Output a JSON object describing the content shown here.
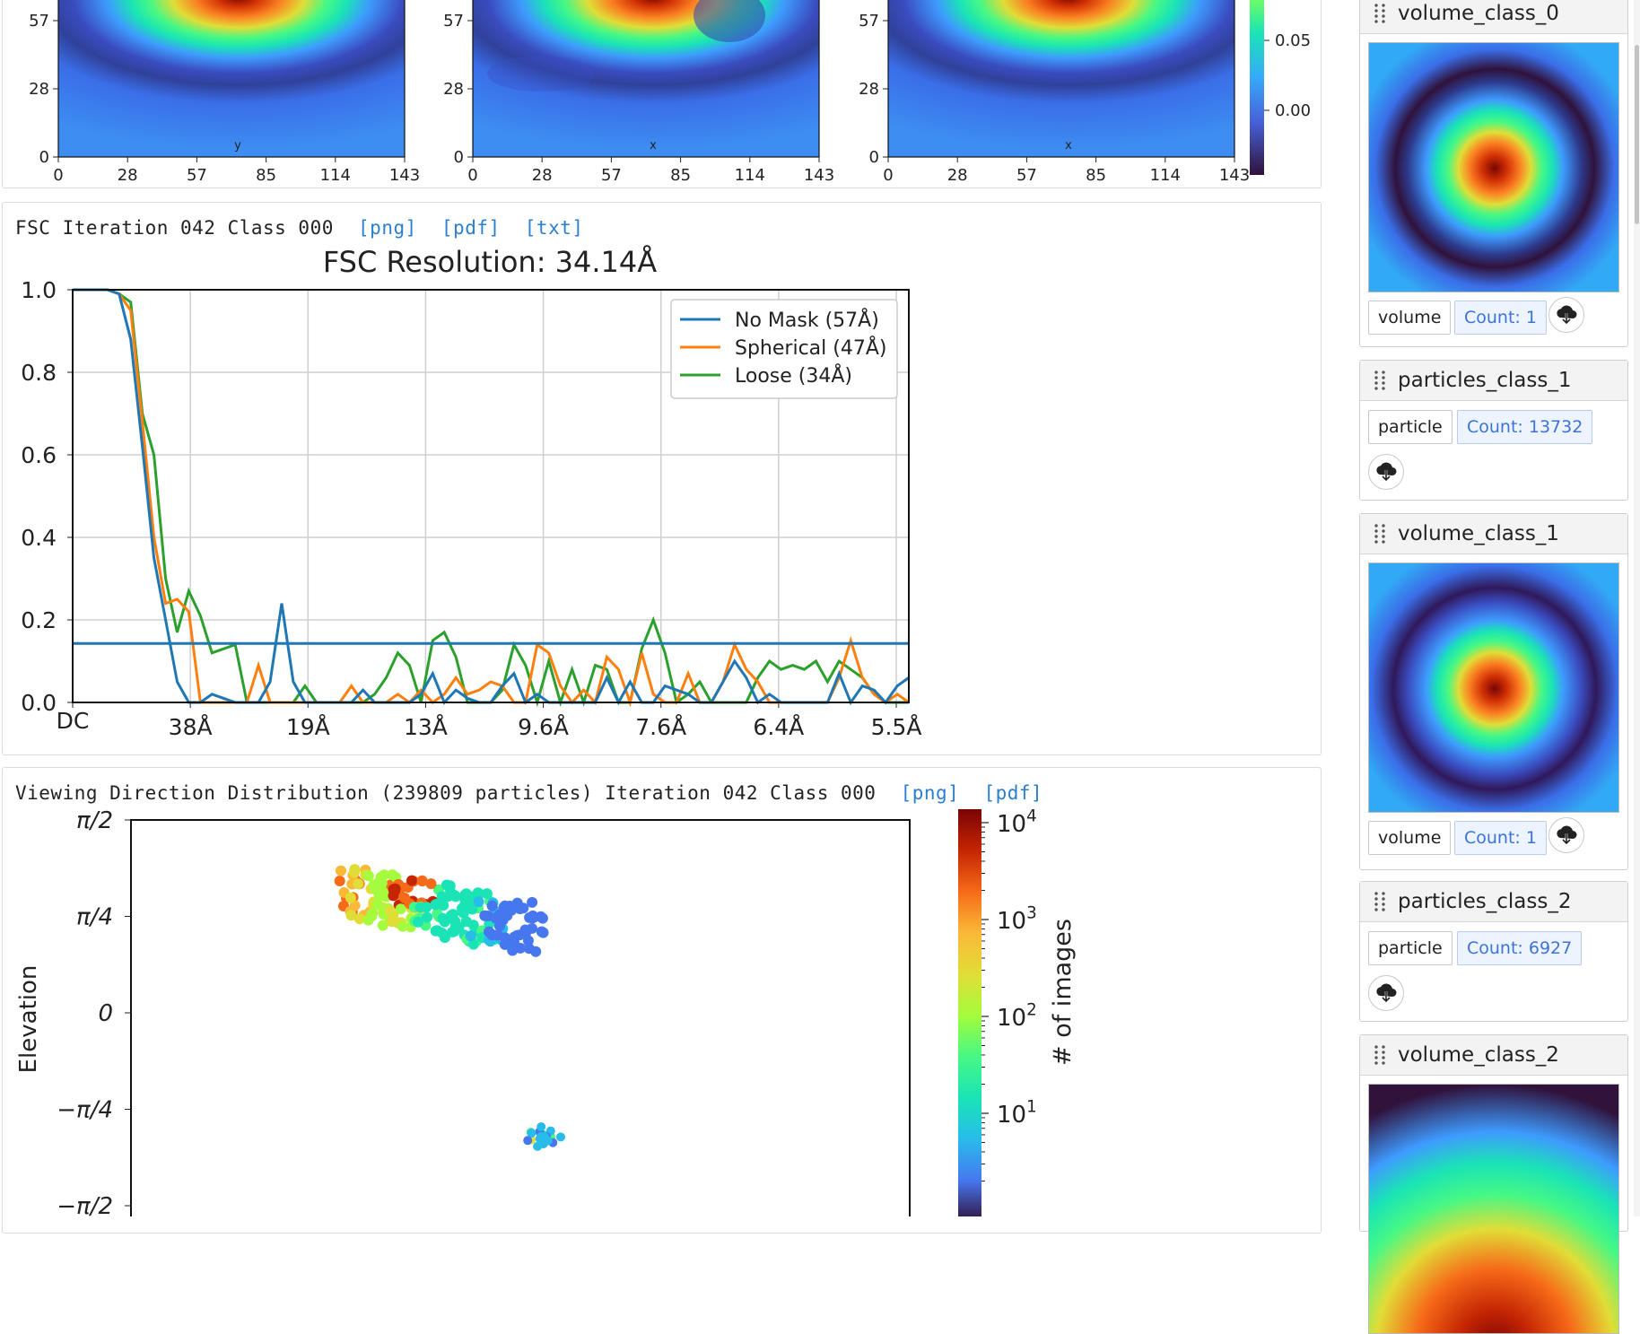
{
  "slices": {
    "x_ticks": [
      "0",
      "28",
      "57",
      "85",
      "114",
      "143"
    ],
    "y_ticks": [
      "57",
      "28",
      "0"
    ],
    "axis_letters": [
      "y",
      "x",
      "x"
    ],
    "colorbar_ticks": [
      "0.05",
      "0.00"
    ]
  },
  "fsc": {
    "header": "FSC Iteration 042 Class 000",
    "links": [
      "[png]",
      "[pdf]",
      "[txt]"
    ]
  },
  "vdd": {
    "header": "Viewing Direction Distribution (239809 particles) Iteration 042 Class 000",
    "links": [
      "[png]",
      "[pdf]"
    ]
  },
  "sidebar": {
    "cards": [
      {
        "title": "volume_class_0",
        "type": "volume",
        "count": "Count: 1"
      },
      {
        "title": "particles_class_1",
        "type": "particle",
        "count": "Count: 13732"
      },
      {
        "title": "volume_class_1",
        "type": "volume",
        "count": "Count: 1"
      },
      {
        "title": "particles_class_2",
        "type": "particle",
        "count": "Count: 6927"
      },
      {
        "title": "volume_class_2"
      }
    ]
  },
  "colors": {
    "no_mask": "#1f77b4",
    "spherical": "#ff7f0e",
    "loose": "#2ca02c",
    "link": "#2b7fd0"
  },
  "chart_data": [
    {
      "type": "line",
      "title": "FSC Resolution: 34.14Å",
      "xlabel": "",
      "ylabel": "",
      "ylim": [
        0,
        1
      ],
      "yticks": [
        "0.0",
        "0.2",
        "0.4",
        "0.6",
        "0.8",
        "1.0"
      ],
      "xticks": [
        "DC",
        "38Å",
        "19Å",
        "13Å",
        "9.6Å",
        "7.6Å",
        "6.4Å",
        "5.5Å"
      ],
      "legend_placement": "top-right",
      "grid": true,
      "threshold": 0.143,
      "x": [
        0,
        1,
        2,
        3,
        4,
        5,
        6,
        7,
        8,
        9,
        10,
        11,
        12,
        13,
        14,
        15,
        16,
        17,
        18,
        19,
        20,
        21,
        22,
        23,
        24,
        25,
        26,
        27,
        28,
        29,
        30,
        31,
        32,
        33,
        34,
        35,
        36,
        37,
        38,
        39,
        40,
        41,
        42,
        43,
        44,
        45,
        46,
        47,
        48,
        49,
        50,
        51,
        52,
        53,
        54,
        55,
        56,
        57,
        58,
        59,
        60,
        61,
        62,
        63,
        64,
        65,
        66,
        67,
        68,
        69,
        70,
        71,
        72
      ],
      "series": [
        {
          "name": "No Mask (57Å)",
          "values": [
            1,
            1,
            1,
            1,
            0.99,
            0.88,
            0.62,
            0.35,
            0.2,
            0.05,
            0.0,
            0.0,
            0.02,
            0.01,
            0.0,
            0.0,
            0.0,
            0.05,
            0.24,
            0.05,
            0.0,
            0.0,
            0.0,
            0.0,
            0.0,
            0.03,
            0.0,
            0.0,
            0.0,
            0.0,
            0.02,
            0.07,
            0.0,
            0.03,
            0.01,
            0.0,
            0.0,
            0.04,
            0.07,
            0.0,
            0.02,
            0.0,
            0.0,
            0.0,
            0.0,
            0.0,
            0.06,
            0.0,
            0.05,
            0.0,
            0.0,
            0.04,
            0.03,
            0.02,
            0.0,
            0.0,
            0.05,
            0.1,
            0.06,
            0.0,
            0.02,
            0.0,
            0.0,
            0.0,
            0.0,
            0.0,
            0.07,
            0.0,
            0.04,
            0.03,
            0.0,
            0.04,
            0.06
          ]
        },
        {
          "name": "Spherical (47Å)",
          "values": [
            1,
            1,
            1,
            1,
            0.99,
            0.95,
            0.68,
            0.4,
            0.24,
            0.25,
            0.22,
            0.0,
            0.0,
            0.0,
            0.0,
            0.0,
            0.09,
            0.0,
            0.0,
            0.0,
            0.0,
            0.0,
            0.0,
            0.0,
            0.04,
            0.0,
            0.0,
            0.0,
            0.02,
            0.0,
            0.03,
            0.0,
            0.02,
            0.06,
            0.02,
            0.03,
            0.05,
            0.04,
            0.0,
            0.0,
            0.14,
            0.12,
            0.04,
            0.0,
            0.03,
            0.0,
            0.11,
            0.08,
            0.0,
            0.12,
            0.02,
            0.0,
            0.0,
            0.07,
            0.0,
            0.0,
            0.05,
            0.14,
            0.08,
            0.05,
            0.0,
            0.0,
            0.0,
            0.0,
            0.0,
            0.0,
            0.06,
            0.15,
            0.06,
            0.02,
            0.0,
            0.02,
            0.0
          ]
        },
        {
          "name": "Loose (34Å)",
          "values": [
            1,
            1,
            1,
            1,
            0.99,
            0.97,
            0.7,
            0.6,
            0.3,
            0.17,
            0.27,
            0.21,
            0.12,
            0.13,
            0.14,
            0.0,
            0.0,
            0.0,
            0.0,
            0.0,
            0.04,
            0.0,
            0.0,
            0.0,
            0.0,
            0.0,
            0.02,
            0.06,
            0.12,
            0.09,
            0.0,
            0.15,
            0.17,
            0.11,
            0.0,
            0.0,
            0.0,
            0.03,
            0.14,
            0.09,
            0.0,
            0.1,
            0.0,
            0.08,
            0.0,
            0.09,
            0.08,
            0.0,
            0.0,
            0.13,
            0.2,
            0.12,
            0.0,
            0.02,
            0.05,
            0.0,
            0.0,
            0.0,
            0.0,
            0.06,
            0.1,
            0.08,
            0.09,
            0.08,
            0.1,
            0.05,
            0.1,
            0.08,
            0.06,
            0.02,
            0.0,
            0.0,
            0.0
          ]
        }
      ]
    },
    {
      "type": "heatmap",
      "title": "",
      "xlabel": "",
      "ylabel": "Elevation",
      "yticks": [
        "π/2",
        "π/4",
        "0",
        "−π/4",
        "−π/2"
      ],
      "ylim": [
        -1.5708,
        1.5708
      ],
      "colorbar_label": "# of images",
      "colorbar_scale": "log",
      "colorbar_ticks": [
        "10^4",
        "10^3",
        "10^2",
        "10^1"
      ],
      "clusters": [
        {
          "azimuth_frac": [
            0.27,
            0.53
          ],
          "elevation": [
            0.4,
            0.9
          ],
          "peak_count": 10000
        },
        {
          "azimuth_frac": [
            0.5,
            0.56
          ],
          "elevation": [
            -1.12,
            -0.95
          ],
          "peak_count": 100
        }
      ]
    }
  ]
}
